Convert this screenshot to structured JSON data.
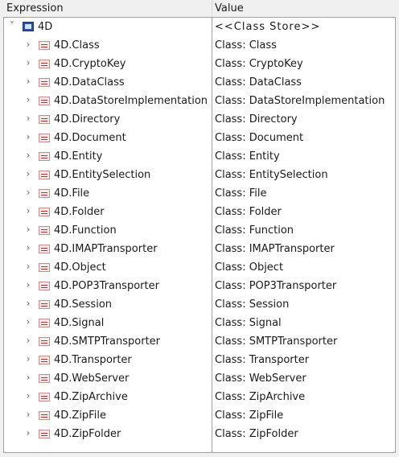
{
  "header": {
    "expression": "Expression",
    "value": "Value"
  },
  "root": {
    "label": "4D",
    "value": "<<Class Store>>",
    "expander": "˅"
  },
  "items": [
    {
      "label": "4D.Class",
      "value": "Class: Class"
    },
    {
      "label": "4D.CryptoKey",
      "value": "Class: CryptoKey"
    },
    {
      "label": "4D.DataClass",
      "value": "Class: DataClass"
    },
    {
      "label": "4D.DataStoreImplementation",
      "value": "Class: DataStoreImplementation"
    },
    {
      "label": "4D.Directory",
      "value": "Class: Directory"
    },
    {
      "label": "4D.Document",
      "value": "Class: Document"
    },
    {
      "label": "4D.Entity",
      "value": "Class: Entity"
    },
    {
      "label": "4D.EntitySelection",
      "value": "Class: EntitySelection"
    },
    {
      "label": "4D.File",
      "value": "Class: File"
    },
    {
      "label": "4D.Folder",
      "value": "Class: Folder"
    },
    {
      "label": "4D.Function",
      "value": "Class: Function"
    },
    {
      "label": "4D.IMAPTransporter",
      "value": "Class: IMAPTransporter"
    },
    {
      "label": "4D.Object",
      "value": "Class: Object"
    },
    {
      "label": "4D.POP3Transporter",
      "value": "Class: POP3Transporter"
    },
    {
      "label": "4D.Session",
      "value": "Class: Session"
    },
    {
      "label": "4D.Signal",
      "value": "Class: Signal"
    },
    {
      "label": "4D.SMTPTransporter",
      "value": "Class: SMTPTransporter"
    },
    {
      "label": "4D.Transporter",
      "value": "Class: Transporter"
    },
    {
      "label": "4D.WebServer",
      "value": "Class: WebServer"
    },
    {
      "label": "4D.ZipArchive",
      "value": "Class: ZipArchive"
    },
    {
      "label": "4D.ZipFile",
      "value": "Class: ZipFile"
    },
    {
      "label": "4D.ZipFolder",
      "value": "Class: ZipFolder"
    }
  ],
  "item_expander": "›",
  "icons": {
    "root": "class-store-icon",
    "item": "class-icon"
  }
}
